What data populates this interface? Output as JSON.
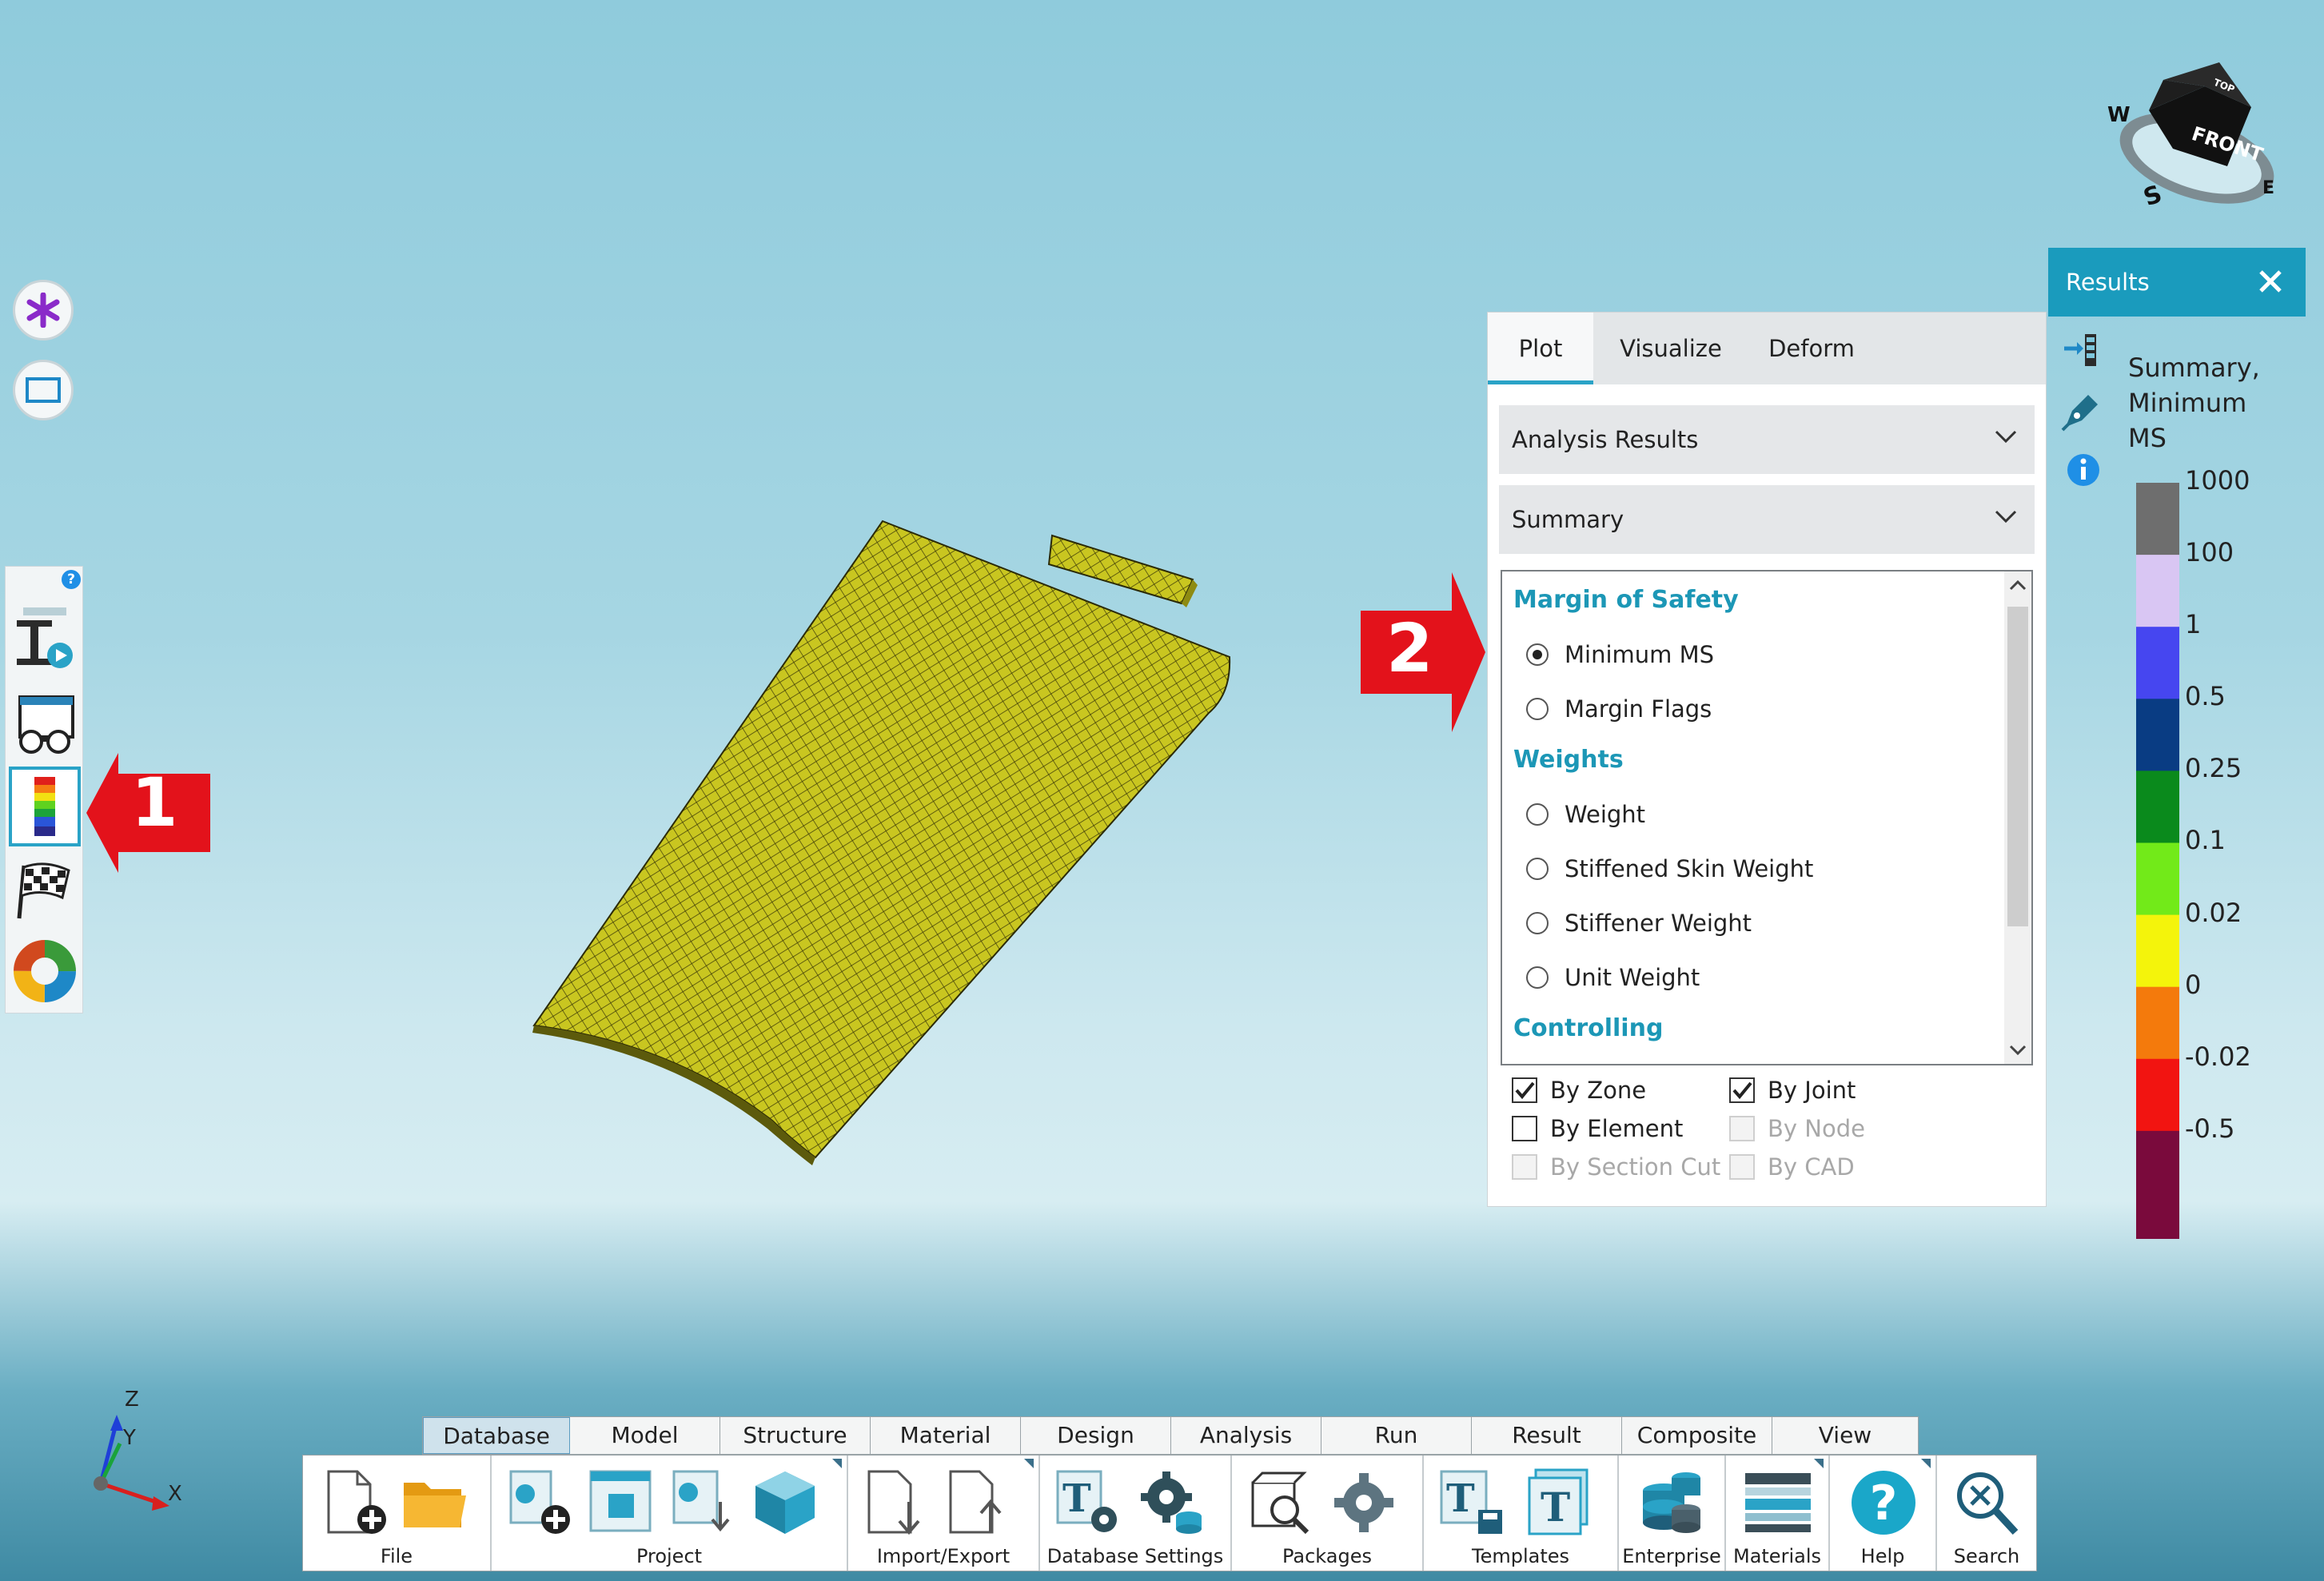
{
  "callouts": [
    "1",
    "2"
  ],
  "plot_panel": {
    "tabs": [
      "Plot",
      "Visualize",
      "Deform"
    ],
    "active_tab": "Plot",
    "dropdown_category": "Analysis Results",
    "dropdown_type": "Summary",
    "list": {
      "groups": [
        {
          "label": "Margin of Safety",
          "items": [
            "Minimum MS",
            "Margin Flags"
          ]
        },
        {
          "label": "Weights",
          "items": [
            "Weight",
            "Stiffened Skin Weight",
            "Stiffener Weight",
            "Unit Weight"
          ]
        },
        {
          "label": "Controlling",
          "items": []
        }
      ],
      "selected": "Minimum MS"
    },
    "checkboxes": [
      {
        "label": "By Zone",
        "checked": true,
        "enabled": true
      },
      {
        "label": "By Joint",
        "checked": true,
        "enabled": true
      },
      {
        "label": "By Element",
        "checked": false,
        "enabled": true
      },
      {
        "label": "By Node",
        "checked": false,
        "enabled": false
      },
      {
        "label": "By Section Cut",
        "checked": false,
        "enabled": false
      },
      {
        "label": "By CAD",
        "checked": false,
        "enabled": false
      }
    ]
  },
  "results_panel": {
    "title": "Results",
    "summary_line1": "Summary,",
    "summary_line2": "Minimum",
    "summary_line3": "MS",
    "legend": {
      "labels": [
        "1000",
        "100",
        "1",
        "0.5",
        "0.25",
        "0.1",
        "0.02",
        "0",
        "-0.02",
        "-0.5"
      ],
      "colors": [
        "#6e6e6e",
        "#d9c6f3",
        "#4646f0",
        "#093c83",
        "#0a8a1c",
        "#72ea19",
        "#f4f40b",
        "#f47a0c",
        "#f21411",
        "#7a0a3c"
      ]
    }
  },
  "view_cube": {
    "face_front": "FRONT",
    "face_top": "TOP",
    "compass": [
      "W",
      "S",
      "E"
    ]
  },
  "axes": {
    "z": "Z",
    "y": "Y",
    "x": "X"
  },
  "ribbon": {
    "tabs": [
      "Database",
      "Model",
      "Structure",
      "Material",
      "Design",
      "Analysis",
      "Run",
      "Result",
      "Composite",
      "View"
    ],
    "active_tab": "Database",
    "groups": [
      "File",
      "Project",
      "Import/Export",
      "Database Settings",
      "Packages",
      "Templates",
      "Enterprise",
      "Materials",
      "Help",
      "Search"
    ]
  },
  "colors": {
    "accent": "#1a9bbd",
    "callout_red": "#e3121b",
    "mesh_yellow": "#c9c620"
  }
}
